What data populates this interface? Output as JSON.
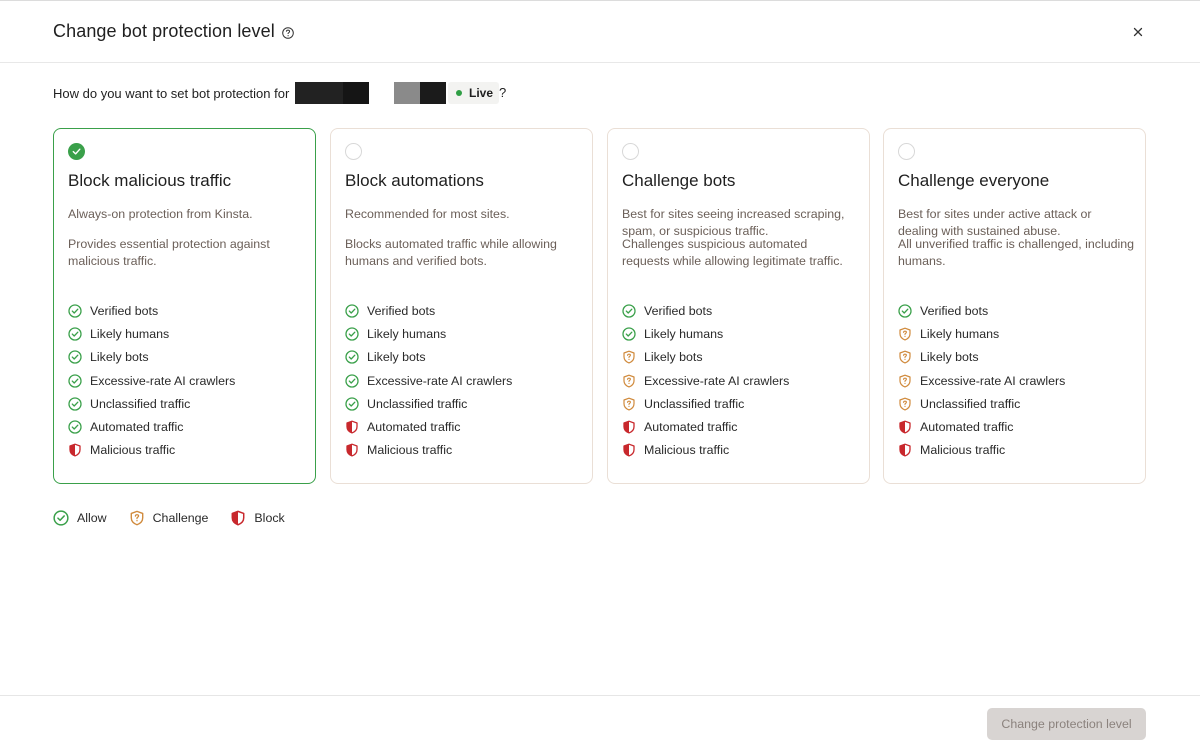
{
  "dialog": {
    "title": "Change bot protection level",
    "help_icon": "question-circle-icon",
    "close_icon": "close-icon"
  },
  "question": {
    "text": "How do you want to set bot protection for",
    "status_badge": "Live",
    "suffix": "?"
  },
  "status_colors": {
    "allow": "#3aa04a",
    "challenge": "#d08a3c",
    "block": "#c8282d",
    "selected_border": "#3aa04a",
    "live_dot": "#2f9e44"
  },
  "options": [
    {
      "title": "Block malicious traffic",
      "selected": true,
      "desc1": "Always-on protection from Kinsta.",
      "desc2": "Provides essential protection against malicious traffic.",
      "features": [
        {
          "label": "Verified bots",
          "status": "allow"
        },
        {
          "label": "Likely humans",
          "status": "allow"
        },
        {
          "label": "Likely bots",
          "status": "allow"
        },
        {
          "label": "Excessive-rate AI crawlers",
          "status": "allow"
        },
        {
          "label": "Unclassified traffic",
          "status": "allow"
        },
        {
          "label": "Automated traffic",
          "status": "allow"
        },
        {
          "label": "Malicious traffic",
          "status": "block"
        }
      ]
    },
    {
      "title": "Block automations",
      "selected": false,
      "desc1": "Recommended for most sites.",
      "desc2": "Blocks automated traffic while allowing humans and verified bots.",
      "features": [
        {
          "label": "Verified bots",
          "status": "allow"
        },
        {
          "label": "Likely humans",
          "status": "allow"
        },
        {
          "label": "Likely bots",
          "status": "allow"
        },
        {
          "label": "Excessive-rate AI crawlers",
          "status": "allow"
        },
        {
          "label": "Unclassified traffic",
          "status": "allow"
        },
        {
          "label": "Automated traffic",
          "status": "block"
        },
        {
          "label": "Malicious traffic",
          "status": "block"
        }
      ]
    },
    {
      "title": "Challenge bots",
      "selected": false,
      "desc1": "Best for sites seeing increased scraping, spam, or suspicious traffic.",
      "desc2": "Challenges suspicious automated requests while allowing legitimate traffic.",
      "features": [
        {
          "label": "Verified bots",
          "status": "allow"
        },
        {
          "label": "Likely humans",
          "status": "allow"
        },
        {
          "label": "Likely bots",
          "status": "challenge"
        },
        {
          "label": "Excessive-rate AI crawlers",
          "status": "challenge"
        },
        {
          "label": "Unclassified traffic",
          "status": "challenge"
        },
        {
          "label": "Automated traffic",
          "status": "block"
        },
        {
          "label": "Malicious traffic",
          "status": "block"
        }
      ]
    },
    {
      "title": "Challenge everyone",
      "selected": false,
      "desc1": "Best for sites under active attack or dealing with sustained abuse.",
      "desc2": "All unverified traffic is challenged, including humans.",
      "features": [
        {
          "label": "Verified bots",
          "status": "allow"
        },
        {
          "label": "Likely humans",
          "status": "challenge"
        },
        {
          "label": "Likely bots",
          "status": "challenge"
        },
        {
          "label": "Excessive-rate AI crawlers",
          "status": "challenge"
        },
        {
          "label": "Unclassified traffic",
          "status": "challenge"
        },
        {
          "label": "Automated traffic",
          "status": "block"
        },
        {
          "label": "Malicious traffic",
          "status": "block"
        }
      ]
    }
  ],
  "legend": [
    {
      "label": "Allow",
      "status": "allow",
      "icon": "check-circle-icon"
    },
    {
      "label": "Challenge",
      "status": "challenge",
      "icon": "shield-question-icon"
    },
    {
      "label": "Block",
      "status": "block",
      "icon": "shield-block-icon"
    }
  ],
  "footer": {
    "submit_label": "Change protection level",
    "submit_disabled": true
  }
}
